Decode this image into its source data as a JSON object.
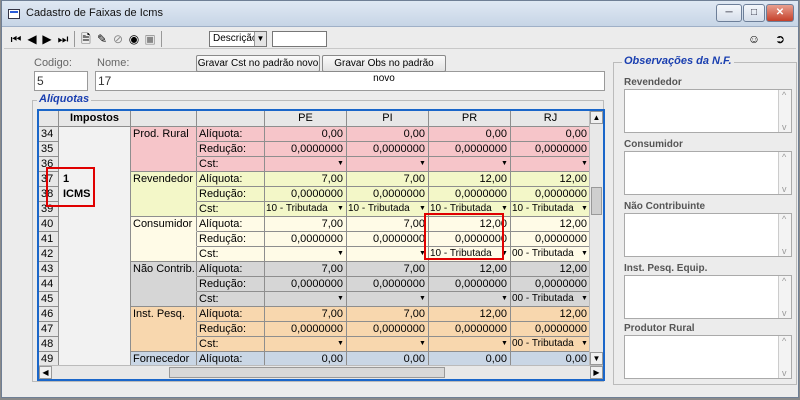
{
  "window": {
    "title": "Cadastro de Faixas de Icms"
  },
  "toolbar": {
    "order_combo": "Descrição",
    "search_value": ""
  },
  "form": {
    "codigo_label": "Codigo:",
    "codigo_value": "5",
    "nome_label": "Nome:",
    "nome_value": "17",
    "btn_gravar_cst": "Gravar Cst no padrão novo",
    "btn_gravar_obs": "Gravar Obs no padrão novo"
  },
  "aliquotas": {
    "legend": "Alíquotas",
    "header_impostos": "Impostos",
    "states": [
      "PE",
      "PI",
      "PR",
      "RJ"
    ],
    "impostos_id": "1",
    "impostos_name": "ICMS",
    "rows": [
      {
        "n": "34",
        "group": "Prod. Rural",
        "label": "Alíquota:",
        "v": [
          "0,00",
          "0,00",
          "0,00",
          "0,00"
        ],
        "cst": false
      },
      {
        "n": "35",
        "group": "",
        "label": "Redução:",
        "v": [
          "0,0000000",
          "0,0000000",
          "0,0000000",
          "0,0000000"
        ],
        "cst": false
      },
      {
        "n": "36",
        "group": "",
        "label": "Cst:",
        "v": [
          "",
          "",
          "",
          ""
        ],
        "cst": true
      },
      {
        "n": "37",
        "group": "Revendedor",
        "label": "Alíquota:",
        "v": [
          "7,00",
          "7,00",
          "12,00",
          "12,00"
        ],
        "cst": false
      },
      {
        "n": "38",
        "group": "",
        "label": "Redução:",
        "v": [
          "0,0000000",
          "0,0000000",
          "0,0000000",
          "0,0000000"
        ],
        "cst": false
      },
      {
        "n": "39",
        "group": "",
        "label": "Cst:",
        "v": [
          "10 - Tributada",
          "10 - Tributada",
          "10 - Tributada",
          "10 - Tributada"
        ],
        "cst": true
      },
      {
        "n": "40",
        "group": "Consumidor",
        "label": "Alíquota:",
        "v": [
          "7,00",
          "7,00",
          "12,00",
          "12,00"
        ],
        "cst": false
      },
      {
        "n": "41",
        "group": "",
        "label": "Redução:",
        "v": [
          "0,0000000",
          "0,0000000",
          "0,0000000",
          "0,0000000"
        ],
        "cst": false
      },
      {
        "n": "42",
        "group": "",
        "label": "Cst:",
        "v": [
          "",
          "",
          "10 - Tributada",
          "00 - Tributada"
        ],
        "cst": true
      },
      {
        "n": "43",
        "group": "Não Contrib.",
        "label": "Alíquota:",
        "v": [
          "7,00",
          "7,00",
          "12,00",
          "12,00"
        ],
        "cst": false
      },
      {
        "n": "44",
        "group": "",
        "label": "Redução:",
        "v": [
          "0,0000000",
          "0,0000000",
          "0,0000000",
          "0,0000000"
        ],
        "cst": false
      },
      {
        "n": "45",
        "group": "",
        "label": "Cst:",
        "v": [
          "",
          "",
          "",
          "00 - Tributada"
        ],
        "cst": true
      },
      {
        "n": "46",
        "group": "Inst. Pesq.",
        "label": "Alíquota:",
        "v": [
          "7,00",
          "7,00",
          "12,00",
          "12,00"
        ],
        "cst": false
      },
      {
        "n": "47",
        "group": "",
        "label": "Redução:",
        "v": [
          "0,0000000",
          "0,0000000",
          "0,0000000",
          "0,0000000"
        ],
        "cst": false
      },
      {
        "n": "48",
        "group": "",
        "label": "Cst:",
        "v": [
          "",
          "",
          "",
          "00 - Tributada"
        ],
        "cst": true
      },
      {
        "n": "49",
        "group": "Fornecedor",
        "label": "Alíquota:",
        "v": [
          "0,00",
          "0,00",
          "0,00",
          "0,00"
        ],
        "cst": false
      }
    ]
  },
  "observacoes": {
    "legend": "Observações da N.F.",
    "fields": [
      "Revendedor",
      "Consumidor",
      "Não Contribuinte",
      "Inst. Pesq. Equip.",
      "Produtor Rural"
    ]
  },
  "colors": {
    "prod_rural": "#f6c5c9",
    "revendedor": "#f3f7c8",
    "consumidor": "#fffbe7",
    "nao_contrib": "#d6d6d6",
    "inst_pesq": "#f8d7ae",
    "fornecedor": "#c9d6e5",
    "highlight": "#e00000",
    "grid_border": "#1a66c9"
  }
}
